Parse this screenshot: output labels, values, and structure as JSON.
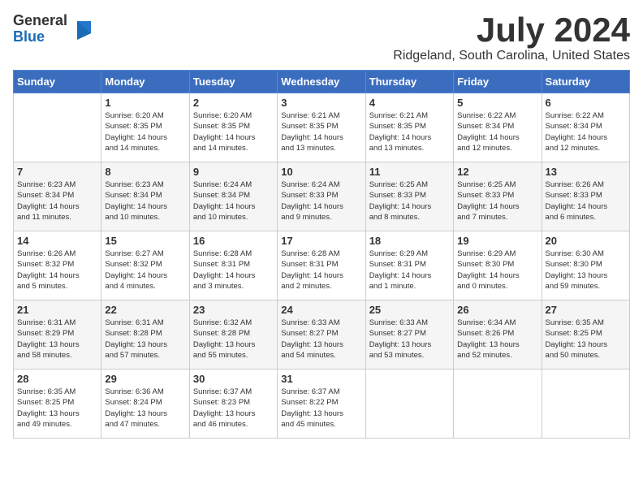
{
  "logo": {
    "general": "General",
    "blue": "Blue"
  },
  "title": {
    "month": "July 2024",
    "location": "Ridgeland, South Carolina, United States"
  },
  "headers": [
    "Sunday",
    "Monday",
    "Tuesday",
    "Wednesday",
    "Thursday",
    "Friday",
    "Saturday"
  ],
  "weeks": [
    [
      {
        "day": "",
        "info": ""
      },
      {
        "day": "1",
        "info": "Sunrise: 6:20 AM\nSunset: 8:35 PM\nDaylight: 14 hours\nand 14 minutes."
      },
      {
        "day": "2",
        "info": "Sunrise: 6:20 AM\nSunset: 8:35 PM\nDaylight: 14 hours\nand 14 minutes."
      },
      {
        "day": "3",
        "info": "Sunrise: 6:21 AM\nSunset: 8:35 PM\nDaylight: 14 hours\nand 13 minutes."
      },
      {
        "day": "4",
        "info": "Sunrise: 6:21 AM\nSunset: 8:35 PM\nDaylight: 14 hours\nand 13 minutes."
      },
      {
        "day": "5",
        "info": "Sunrise: 6:22 AM\nSunset: 8:34 PM\nDaylight: 14 hours\nand 12 minutes."
      },
      {
        "day": "6",
        "info": "Sunrise: 6:22 AM\nSunset: 8:34 PM\nDaylight: 14 hours\nand 12 minutes."
      }
    ],
    [
      {
        "day": "7",
        "info": "Sunrise: 6:23 AM\nSunset: 8:34 PM\nDaylight: 14 hours\nand 11 minutes."
      },
      {
        "day": "8",
        "info": "Sunrise: 6:23 AM\nSunset: 8:34 PM\nDaylight: 14 hours\nand 10 minutes."
      },
      {
        "day": "9",
        "info": "Sunrise: 6:24 AM\nSunset: 8:34 PM\nDaylight: 14 hours\nand 10 minutes."
      },
      {
        "day": "10",
        "info": "Sunrise: 6:24 AM\nSunset: 8:33 PM\nDaylight: 14 hours\nand 9 minutes."
      },
      {
        "day": "11",
        "info": "Sunrise: 6:25 AM\nSunset: 8:33 PM\nDaylight: 14 hours\nand 8 minutes."
      },
      {
        "day": "12",
        "info": "Sunrise: 6:25 AM\nSunset: 8:33 PM\nDaylight: 14 hours\nand 7 minutes."
      },
      {
        "day": "13",
        "info": "Sunrise: 6:26 AM\nSunset: 8:33 PM\nDaylight: 14 hours\nand 6 minutes."
      }
    ],
    [
      {
        "day": "14",
        "info": "Sunrise: 6:26 AM\nSunset: 8:32 PM\nDaylight: 14 hours\nand 5 minutes."
      },
      {
        "day": "15",
        "info": "Sunrise: 6:27 AM\nSunset: 8:32 PM\nDaylight: 14 hours\nand 4 minutes."
      },
      {
        "day": "16",
        "info": "Sunrise: 6:28 AM\nSunset: 8:31 PM\nDaylight: 14 hours\nand 3 minutes."
      },
      {
        "day": "17",
        "info": "Sunrise: 6:28 AM\nSunset: 8:31 PM\nDaylight: 14 hours\nand 2 minutes."
      },
      {
        "day": "18",
        "info": "Sunrise: 6:29 AM\nSunset: 8:31 PM\nDaylight: 14 hours\nand 1 minute."
      },
      {
        "day": "19",
        "info": "Sunrise: 6:29 AM\nSunset: 8:30 PM\nDaylight: 14 hours\nand 0 minutes."
      },
      {
        "day": "20",
        "info": "Sunrise: 6:30 AM\nSunset: 8:30 PM\nDaylight: 13 hours\nand 59 minutes."
      }
    ],
    [
      {
        "day": "21",
        "info": "Sunrise: 6:31 AM\nSunset: 8:29 PM\nDaylight: 13 hours\nand 58 minutes."
      },
      {
        "day": "22",
        "info": "Sunrise: 6:31 AM\nSunset: 8:28 PM\nDaylight: 13 hours\nand 57 minutes."
      },
      {
        "day": "23",
        "info": "Sunrise: 6:32 AM\nSunset: 8:28 PM\nDaylight: 13 hours\nand 55 minutes."
      },
      {
        "day": "24",
        "info": "Sunrise: 6:33 AM\nSunset: 8:27 PM\nDaylight: 13 hours\nand 54 minutes."
      },
      {
        "day": "25",
        "info": "Sunrise: 6:33 AM\nSunset: 8:27 PM\nDaylight: 13 hours\nand 53 minutes."
      },
      {
        "day": "26",
        "info": "Sunrise: 6:34 AM\nSunset: 8:26 PM\nDaylight: 13 hours\nand 52 minutes."
      },
      {
        "day": "27",
        "info": "Sunrise: 6:35 AM\nSunset: 8:25 PM\nDaylight: 13 hours\nand 50 minutes."
      }
    ],
    [
      {
        "day": "28",
        "info": "Sunrise: 6:35 AM\nSunset: 8:25 PM\nDaylight: 13 hours\nand 49 minutes."
      },
      {
        "day": "29",
        "info": "Sunrise: 6:36 AM\nSunset: 8:24 PM\nDaylight: 13 hours\nand 47 minutes."
      },
      {
        "day": "30",
        "info": "Sunrise: 6:37 AM\nSunset: 8:23 PM\nDaylight: 13 hours\nand 46 minutes."
      },
      {
        "day": "31",
        "info": "Sunrise: 6:37 AM\nSunset: 8:22 PM\nDaylight: 13 hours\nand 45 minutes."
      },
      {
        "day": "",
        "info": ""
      },
      {
        "day": "",
        "info": ""
      },
      {
        "day": "",
        "info": ""
      }
    ]
  ]
}
